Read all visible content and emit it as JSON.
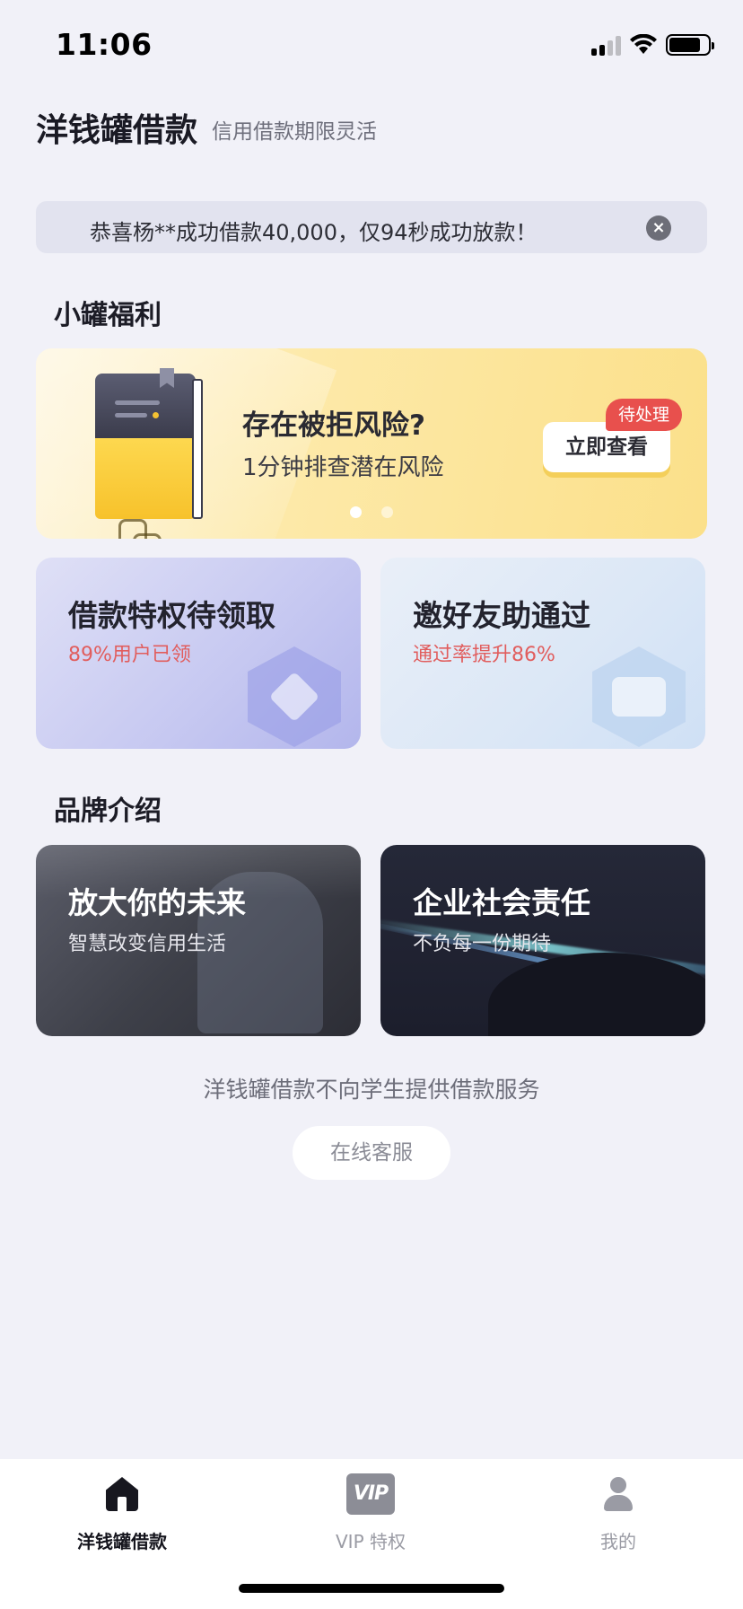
{
  "status_bar": {
    "time": "11:06"
  },
  "header": {
    "title": "洋钱罐借款",
    "subtitle": "信用借款期限灵活"
  },
  "notice": {
    "text": "恭喜杨**成功借款40,000，仅94秒成功放款！",
    "close_icon": "×"
  },
  "welfare": {
    "section_title": "小罐福利",
    "banner": {
      "title": "存在被拒风险?",
      "subtitle": "1分钟排查潜在风险",
      "button_label": "立即查看",
      "badge": "待处理",
      "page_count": 2,
      "active_page": 1
    },
    "cards": [
      {
        "title": "借款特权待领取",
        "subtitle": "89%用户已领"
      },
      {
        "title": "邀好友助通过",
        "subtitle": "通过率提升86%"
      }
    ]
  },
  "brand": {
    "section_title": "品牌介绍",
    "cards": [
      {
        "title": "放大你的未来",
        "subtitle": "智慧改变信用生活"
      },
      {
        "title": "企业社会责任",
        "subtitle": "不负每一份期待"
      }
    ]
  },
  "footer": {
    "disclaimer": "洋钱罐借款不向学生提供借款服务",
    "support_button": "在线客服"
  },
  "tab_bar": {
    "items": [
      {
        "label": "洋钱罐借款",
        "icon": "home-icon",
        "active": true
      },
      {
        "label": "VIP 特权",
        "icon": "vip-icon",
        "icon_text": "VIP",
        "active": false
      },
      {
        "label": "我的",
        "icon": "user-icon",
        "active": false
      }
    ]
  },
  "colors": {
    "background": "#f1f1f8",
    "badge_red": "#e8504d",
    "highlight_red": "#e15d5d",
    "banner_yellow": "#fbe08a"
  }
}
